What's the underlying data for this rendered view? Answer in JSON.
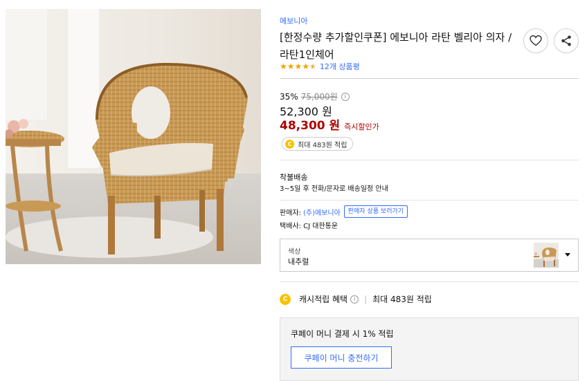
{
  "product": {
    "brand": "에보니아",
    "title": "[한정수량 추가할인쿠폰] 에보니아 라탄 벨리아 의자 / 라탄1인체어",
    "rating_value": 4.5,
    "review_count_text": "12개 상품평",
    "image_desc": "rattan-armchair-photo"
  },
  "actions": {
    "wishlist_icon": "heart-icon",
    "share_icon": "share-icon"
  },
  "price": {
    "discount_rate": "35%",
    "original_price": "75,000원",
    "sale_price": "52,300 원",
    "instant_discount_price": "48,300 원",
    "instant_discount_label": "즉시할인가"
  },
  "cash_badge": {
    "coin_symbol": "C",
    "text": "최대 483원 적립"
  },
  "shipping": {
    "type": "착불배송",
    "info": "3~5일 후 전화/문자로 배송일정 안내"
  },
  "seller": {
    "label": "판매자:",
    "name": "(주)에보니아",
    "link_label": "판매자 상품 보러가기",
    "courier": "택배사: CJ 대한통운"
  },
  "option": {
    "label": "색상",
    "value": "내추럴"
  },
  "benefit": {
    "title": "캐시적립 혜택",
    "separator": "|",
    "detail": "최대 483원 적립"
  },
  "coupay": {
    "text": "쿠페이 머니 결제 시 1% 적립",
    "button_label": "쿠페이 머니 충전하기"
  },
  "colors": {
    "accent_blue": "#346aff",
    "price_red": "#ae0000",
    "coin_yellow": "#f7c300",
    "star": "#f0a500"
  }
}
